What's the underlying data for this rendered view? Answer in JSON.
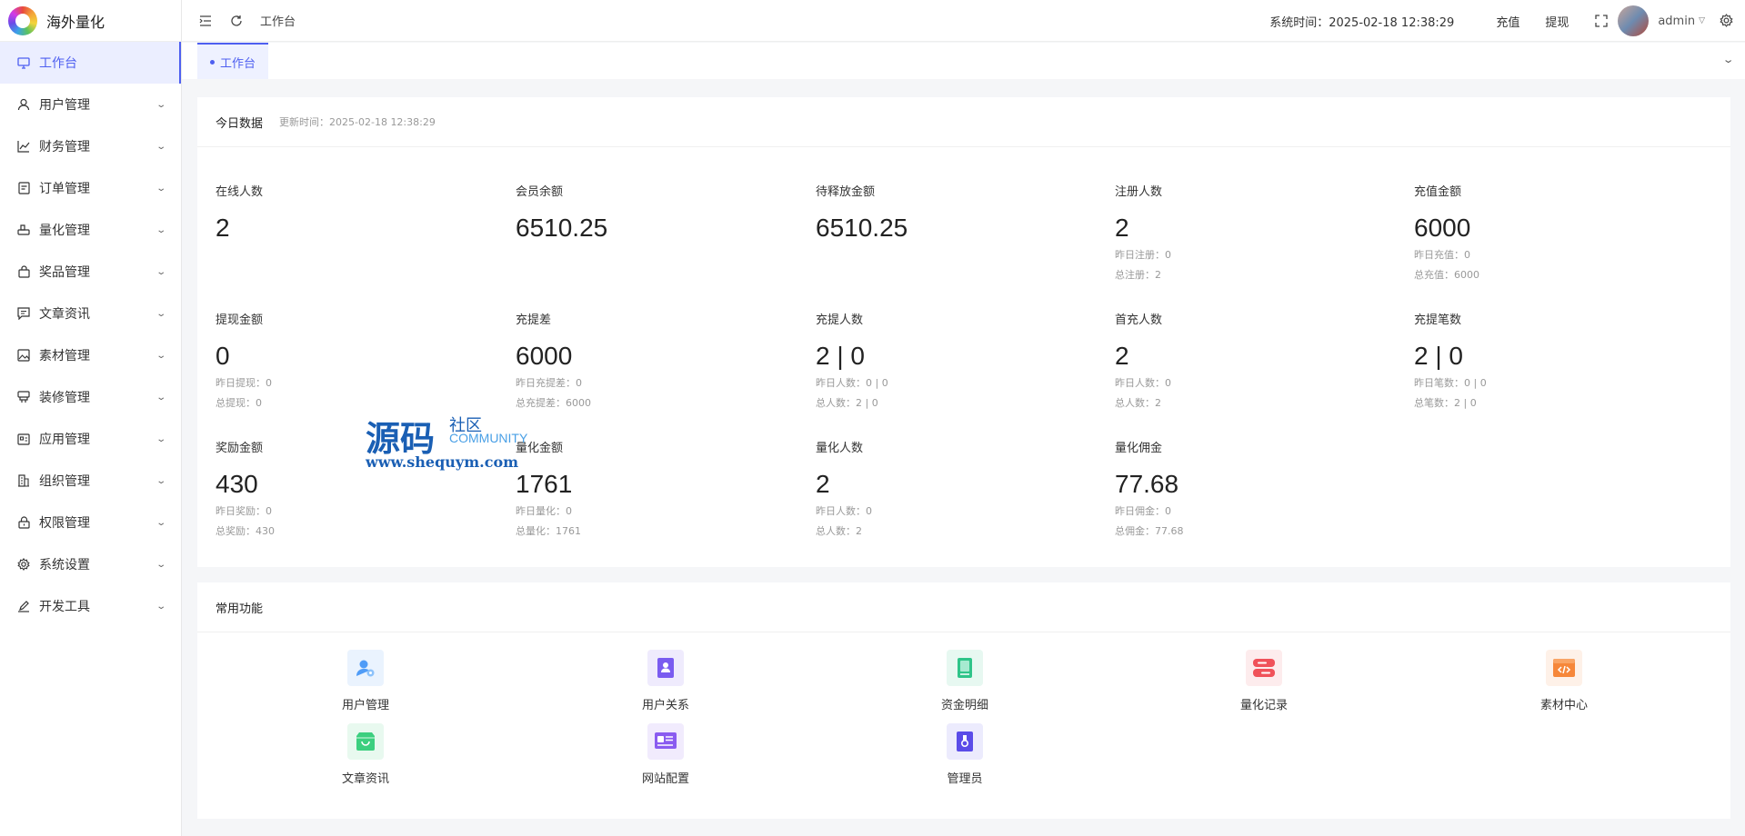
{
  "app": {
    "name": "海外量化"
  },
  "sidebar": {
    "items": [
      {
        "label": "工作台",
        "icon": "monitor-icon",
        "active": true
      },
      {
        "label": "用户管理",
        "icon": "user-icon"
      },
      {
        "label": "财务管理",
        "icon": "chart-icon"
      },
      {
        "label": "订单管理",
        "icon": "document-icon"
      },
      {
        "label": "量化管理",
        "icon": "printer-icon"
      },
      {
        "label": "奖品管理",
        "icon": "bag-icon"
      },
      {
        "label": "文章资讯",
        "icon": "message-icon"
      },
      {
        "label": "素材管理",
        "icon": "picture-icon"
      },
      {
        "label": "装修管理",
        "icon": "brush-icon"
      },
      {
        "label": "应用管理",
        "icon": "app-icon"
      },
      {
        "label": "组织管理",
        "icon": "office-icon"
      },
      {
        "label": "权限管理",
        "icon": "lock-icon"
      },
      {
        "label": "系统设置",
        "icon": "setting-icon"
      },
      {
        "label": "开发工具",
        "icon": "edit-pen-icon"
      }
    ]
  },
  "header": {
    "breadcrumb": "工作台",
    "system_time": "系统时间：2025-02-18 12:38:29",
    "recharge": "充值",
    "withdraw": "提现",
    "username": "admin"
  },
  "tabs": [
    {
      "label": "工作台"
    }
  ],
  "today": {
    "title": "今日数据",
    "updated": "更新时间：2025-02-18 12:38:29",
    "stats": [
      {
        "label": "在线人数",
        "value": "2",
        "sub": []
      },
      {
        "label": "会员余额",
        "value": "6510.25",
        "sub": []
      },
      {
        "label": "待释放金额",
        "value": "6510.25",
        "sub": []
      },
      {
        "label": "注册人数",
        "value": "2",
        "sub": [
          "昨日注册：0",
          "总注册：2"
        ]
      },
      {
        "label": "充值金额",
        "value": "6000",
        "sub": [
          "昨日充值：0",
          "总充值：6000"
        ]
      },
      {
        "label": "提现金额",
        "value": "0",
        "sub": [
          "昨日提现：0",
          "总提现：0"
        ]
      },
      {
        "label": "充提差",
        "value": "6000",
        "sub": [
          "昨日充提差：0",
          "总充提差：6000"
        ]
      },
      {
        "label": "充提人数",
        "value": "2 | 0",
        "sub": [
          "昨日人数：0 | 0",
          "总人数：2 | 0"
        ]
      },
      {
        "label": "首充人数",
        "value": "2",
        "sub": [
          "昨日人数：0",
          "总人数：2"
        ]
      },
      {
        "label": "充提笔数",
        "value": "2 | 0",
        "sub": [
          "昨日笔数：0 | 0",
          "总笔数：2 | 0"
        ]
      },
      {
        "label": "奖励金额",
        "value": "430",
        "sub": [
          "昨日奖励：0",
          "总奖励：430"
        ]
      },
      {
        "label": "量化金额",
        "value": "1761",
        "sub": [
          "昨日量化：0",
          "总量化：1761"
        ]
      },
      {
        "label": "量化人数",
        "value": "2",
        "sub": [
          "昨日人数：0",
          "总人数：2"
        ]
      },
      {
        "label": "量化佣金",
        "value": "77.68",
        "sub": [
          "昨日佣金：0",
          "总佣金：77.68"
        ]
      }
    ]
  },
  "common": {
    "title": "常用功能",
    "items": [
      {
        "label": "用户管理",
        "icon": "user-setting-icon",
        "color": "#4f9cf7",
        "bg": "#eaf3fe"
      },
      {
        "label": "用户关系",
        "icon": "contact-book-icon",
        "color": "#7a5cf0",
        "bg": "#efebfd"
      },
      {
        "label": "资金明细",
        "icon": "ledger-icon",
        "color": "#2fc489",
        "bg": "#e7f8f1"
      },
      {
        "label": "量化记录",
        "icon": "server-icon",
        "color": "#f0525a",
        "bg": "#fdeced"
      },
      {
        "label": "素材中心",
        "icon": "code-window-icon",
        "color": "#f6873a",
        "bg": "#fef1e8"
      },
      {
        "label": "文章资讯",
        "icon": "inbox-icon",
        "color": "#3ccf7f",
        "bg": "#e8f9ef"
      },
      {
        "label": "网站配置",
        "icon": "id-card-icon",
        "color": "#8a5cf0",
        "bg": "#f1ebfd"
      },
      {
        "label": "管理员",
        "icon": "badge-icon",
        "color": "#5a4ce8",
        "bg": "#ecebfd"
      }
    ]
  },
  "watermark": {
    "main": "源码",
    "side": "社区",
    "community": "COMMUNITY",
    "url": "www.shequym.com"
  },
  "colors": {
    "accent": "#4e5ff0",
    "active_bg": "#ebeeff"
  }
}
